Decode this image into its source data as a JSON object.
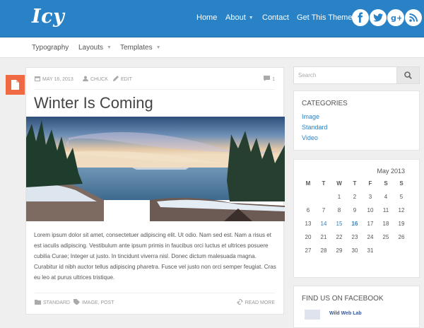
{
  "site": {
    "logo_text": "Icy"
  },
  "main_nav": [
    {
      "label": "Home",
      "has_caret": false
    },
    {
      "label": "About",
      "has_caret": true
    },
    {
      "label": "Contact",
      "has_caret": false
    },
    {
      "label": "Get This Theme",
      "has_caret": false
    }
  ],
  "social": [
    "facebook-icon",
    "twitter-icon",
    "google-plus-icon",
    "rss-icon"
  ],
  "sub_nav": [
    {
      "label": "Typography",
      "has_caret": false
    },
    {
      "label": "Layouts",
      "has_caret": true
    },
    {
      "label": "Templates",
      "has_caret": true
    }
  ],
  "post": {
    "date": "MAY 16, 2013",
    "author": "CHUCK",
    "edit": "EDIT",
    "comments": "1",
    "title": "Winter Is Coming",
    "excerpt": "Lorem ipsum dolor sit amet, consectetuer adipiscing elit. Ut odio. Nam sed est. Nam a risus et est iaculis adipiscing. Vestibulum ante ipsum primis in faucibus orci luctus et ultrices posuere cubilia Curae; Integer ut justo. In tincidunt viverra nisl. Donec dictum malesuada magna. Curabitur id nibh auctor tellus adipiscing pharetra. Fusce vel justo non orci semper feugiat. Cras eu leo at purus ultrices tristique.",
    "category": "STANDARD",
    "tags": "IMAGE, POST",
    "read_more": "READ MORE"
  },
  "search": {
    "placeholder": "Search"
  },
  "categories": {
    "title": "CATEGORIES",
    "items": [
      "Image",
      "Standard",
      "Video"
    ]
  },
  "calendar": {
    "caption": "May 2013",
    "days": [
      "M",
      "T",
      "W",
      "T",
      "F",
      "S",
      "S"
    ],
    "weeks": [
      [
        "",
        "",
        "1",
        "2",
        "3",
        "4",
        "5"
      ],
      [
        "6",
        "7",
        "8",
        "9",
        "10",
        "11",
        "12"
      ],
      [
        "13",
        "14",
        "15",
        "16",
        "17",
        "18",
        "19"
      ],
      [
        "20",
        "21",
        "22",
        "23",
        "24",
        "25",
        "26"
      ],
      [
        "27",
        "28",
        "29",
        "30",
        "31",
        "",
        ""
      ]
    ],
    "linked_days": [
      "14",
      "15"
    ],
    "today": "16"
  },
  "facebook": {
    "title": "FIND US ON FACEBOOK",
    "page_name": "Wild Web Lab"
  },
  "colors": {
    "brand_blue": "#2a82c6",
    "format_orange": "#ef6a43"
  }
}
